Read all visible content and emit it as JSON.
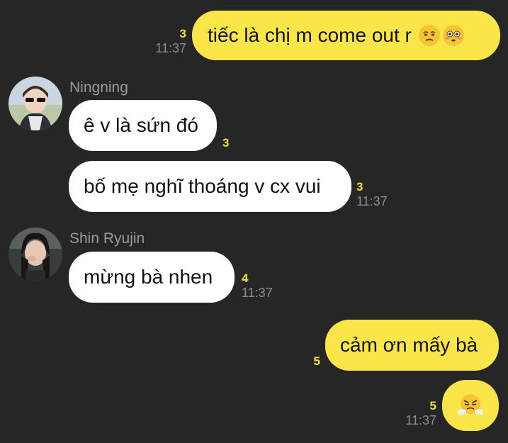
{
  "messages": [
    {
      "id": "m1",
      "sender": "me",
      "text": "tiếc là chị m come out r",
      "emojis": [
        "unamused-face-emoji",
        "flushed-face-emoji"
      ],
      "read_count": "3",
      "time": "11:37"
    },
    {
      "id": "m2",
      "sender": "Ningning",
      "text": "ê v là sứn đó",
      "read_count": "3"
    },
    {
      "id": "m3",
      "sender": "Ningning",
      "text": "bố mẹ nghĩ thoáng v cx vui",
      "read_count": "3",
      "time": "11:37"
    },
    {
      "id": "m4",
      "sender": "Shin Ryujin",
      "text": "mừng bà nhen",
      "read_count": "4",
      "time": "11:37"
    },
    {
      "id": "m5",
      "sender": "me",
      "text": "cảm ơn mấy bà",
      "read_count": "5"
    },
    {
      "id": "m6",
      "sender": "me",
      "emoji": "face-with-steam-emoji",
      "read_count": "5",
      "time": "11:37"
    }
  ],
  "contacts": {
    "ningning": {
      "name": "Ningning",
      "avatar": "ningning-avatar"
    },
    "ryujin": {
      "name": "Shin Ryujin",
      "avatar": "ryujin-avatar"
    }
  },
  "colors": {
    "background": "#262626",
    "my_bubble": "#fbe64a",
    "their_bubble": "#ffffff",
    "read_count": "#f3df3d",
    "timestamp": "#8e8e8e",
    "sender_name": "#9a9a9a"
  }
}
